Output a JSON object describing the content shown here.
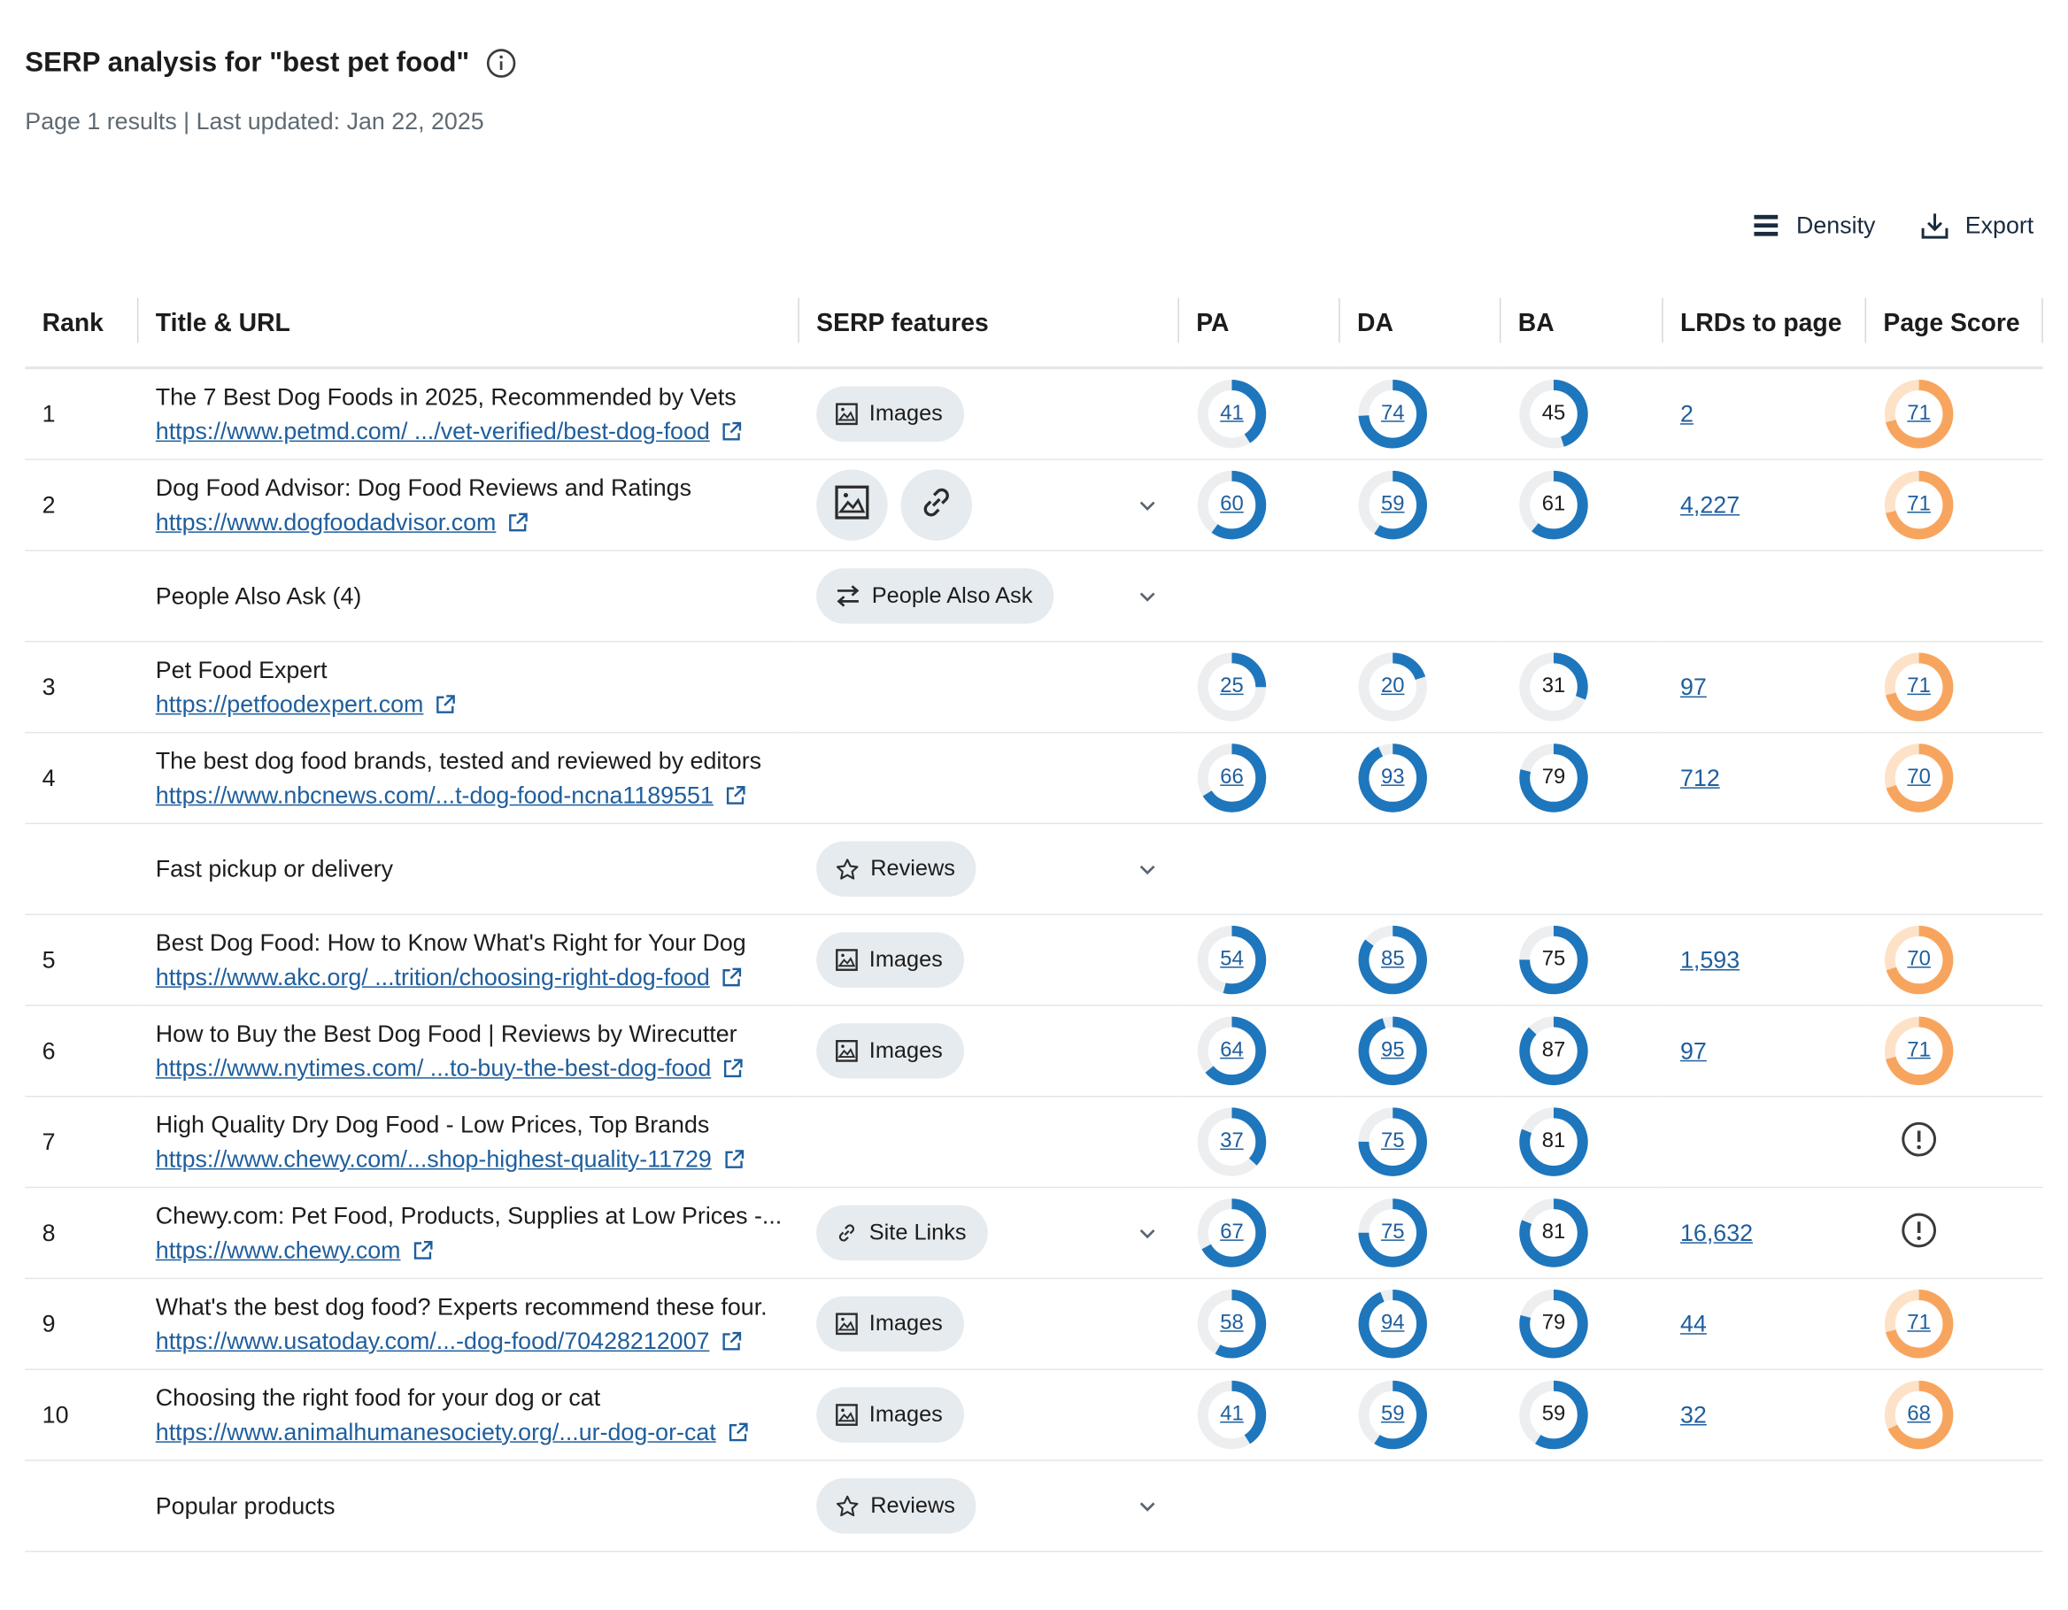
{
  "header": {
    "title": "SERP analysis for \"best pet food\"",
    "subtitle": "Page 1 results | Last updated: Jan 22, 2025"
  },
  "toolbar": {
    "density_label": "Density",
    "export_label": "Export"
  },
  "columns": [
    "Rank",
    "Title & URL",
    "SERP features",
    "PA",
    "DA",
    "BA",
    "LRDs to page",
    "Page Score"
  ],
  "colors": {
    "pa_da_ba_fill": "#1e76bd",
    "pa_da_ba_track": "#eceef0",
    "score_fill": "#f7a55e",
    "score_track": "#fde2c8",
    "link": "#1f5e9c"
  },
  "rows": [
    {
      "type": "result",
      "rank": "1",
      "title": "The 7 Best Dog Foods in 2025, Recommended by Vets",
      "url": "https://www.petmd.com/ .../vet-verified/best-dog-food",
      "features": [
        {
          "kind": "chip",
          "icon": "image-icon",
          "label": "Images"
        }
      ],
      "expand": false,
      "pa": 41,
      "da": 74,
      "ba": 45,
      "lrd": "2",
      "score": 71
    },
    {
      "type": "result",
      "rank": "2",
      "title": "Dog Food Advisor: Dog Food Reviews and Ratings",
      "url": "https://www.dogfoodadvisor.com",
      "features": [
        {
          "kind": "round",
          "icon": "image-icon"
        },
        {
          "kind": "round",
          "icon": "link-icon"
        }
      ],
      "expand": true,
      "pa": 60,
      "da": 59,
      "ba": 61,
      "lrd": "4,227",
      "score": 71
    },
    {
      "type": "feature",
      "label": "People Also Ask (4)",
      "features": [
        {
          "kind": "chip",
          "icon": "swap-icon",
          "label": "People Also Ask"
        }
      ],
      "expand": true
    },
    {
      "type": "result",
      "rank": "3",
      "title": "Pet Food Expert",
      "url": "https://petfoodexpert.com",
      "features": [],
      "expand": false,
      "pa": 25,
      "da": 20,
      "ba": 31,
      "lrd": "97",
      "score": 71
    },
    {
      "type": "result",
      "rank": "4",
      "title": "The best dog food brands, tested and reviewed by editors",
      "url": "https://www.nbcnews.com/...t-dog-food-ncna1189551",
      "features": [],
      "expand": false,
      "pa": 66,
      "da": 93,
      "ba": 79,
      "lrd": "712",
      "score": 70
    },
    {
      "type": "feature",
      "label": "Fast pickup or delivery",
      "features": [
        {
          "kind": "chip",
          "icon": "star-icon",
          "label": "Reviews"
        }
      ],
      "expand": true
    },
    {
      "type": "result",
      "rank": "5",
      "title": "Best Dog Food: How to Know What's Right for Your Dog",
      "url": "https://www.akc.org/ ...trition/choosing-right-dog-food",
      "features": [
        {
          "kind": "chip",
          "icon": "image-icon",
          "label": "Images"
        }
      ],
      "expand": false,
      "pa": 54,
      "da": 85,
      "ba": 75,
      "lrd": "1,593",
      "score": 70
    },
    {
      "type": "result",
      "rank": "6",
      "title": "How to Buy the Best Dog Food | Reviews by Wirecutter",
      "url": "https://www.nytimes.com/ ...to-buy-the-best-dog-food",
      "features": [
        {
          "kind": "chip",
          "icon": "image-icon",
          "label": "Images"
        }
      ],
      "expand": false,
      "pa": 64,
      "da": 95,
      "ba": 87,
      "lrd": "97",
      "score": 71
    },
    {
      "type": "result",
      "rank": "7",
      "title": "High Quality Dry Dog Food - Low Prices, Top Brands",
      "url": "https://www.chewy.com/...shop-highest-quality-11729",
      "features": [],
      "expand": false,
      "pa": 37,
      "da": 75,
      "ba": 81,
      "lrd": "",
      "score": null
    },
    {
      "type": "result",
      "rank": "8",
      "title": "Chewy.com: Pet Food, Products, Supplies at Low Prices -...",
      "url": "https://www.chewy.com",
      "features": [
        {
          "kind": "chip",
          "icon": "link-icon",
          "label": "Site Links"
        }
      ],
      "expand": true,
      "pa": 67,
      "da": 75,
      "ba": 81,
      "lrd": "16,632",
      "score": null
    },
    {
      "type": "result",
      "rank": "9",
      "title": "What's the best dog food? Experts recommend these four.",
      "url": "https://www.usatoday.com/...-dog-food/70428212007",
      "features": [
        {
          "kind": "chip",
          "icon": "image-icon",
          "label": "Images"
        }
      ],
      "expand": false,
      "pa": 58,
      "da": 94,
      "ba": 79,
      "lrd": "44",
      "score": 71
    },
    {
      "type": "result",
      "rank": "10",
      "title": "Choosing the right food for your dog or cat",
      "url": "https://www.animalhumanesociety.org/...ur-dog-or-cat",
      "features": [
        {
          "kind": "chip",
          "icon": "image-icon",
          "label": "Images"
        }
      ],
      "expand": false,
      "pa": 41,
      "da": 59,
      "ba": 59,
      "lrd": "32",
      "score": 68
    },
    {
      "type": "feature",
      "label": "Popular products",
      "features": [
        {
          "kind": "chip",
          "icon": "star-icon",
          "label": "Reviews"
        }
      ],
      "expand": true
    }
  ]
}
